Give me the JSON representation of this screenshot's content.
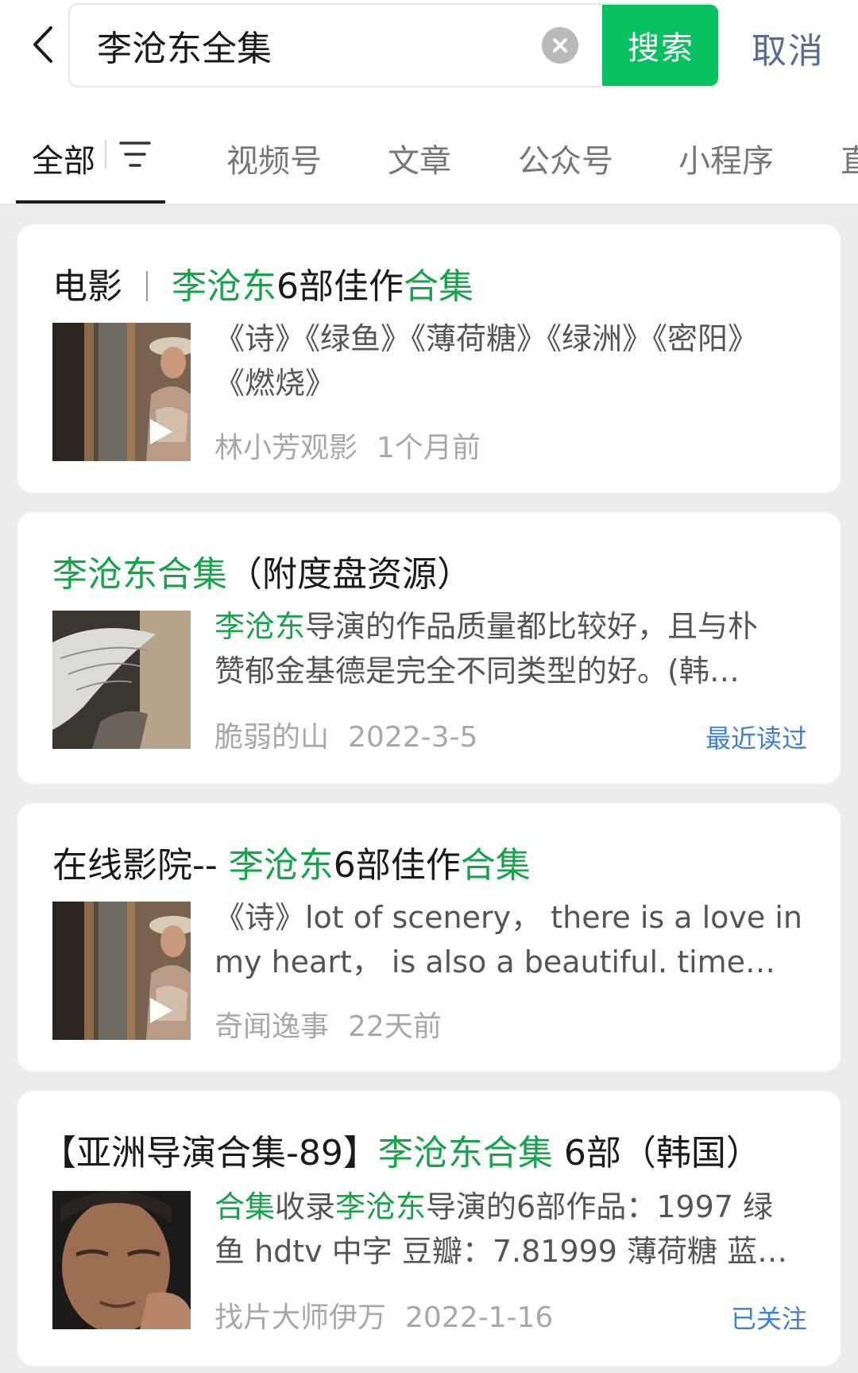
{
  "search": {
    "query": "李沧东全集",
    "submit_label": "搜索",
    "cancel_label": "取消"
  },
  "tabs": [
    {
      "label": "全部",
      "active": true
    },
    {
      "label": "视频号"
    },
    {
      "label": "文章"
    },
    {
      "label": "公众号"
    },
    {
      "label": "小程序"
    },
    {
      "label": "直"
    }
  ],
  "colors": {
    "accent_green": "#07c160",
    "highlight_green": "#17a34a",
    "link_blue": "#576b95",
    "badge_blue": "#3f7fd6"
  },
  "results": [
    {
      "category": "电影",
      "title_parts": [
        {
          "text": "李沧东",
          "hl": true
        },
        {
          "text": "6部佳作",
          "hl": false
        },
        {
          "text": "合集",
          "hl": true
        }
      ],
      "thumb": "woman-in-hat-video-thumb",
      "is_video": true,
      "desc_lines": [
        [
          {
            "text": "《诗》《绿鱼》《薄荷糖》《绿洲》《密阳》",
            "hl": false
          }
        ],
        [
          {
            "text": "《燃烧》",
            "hl": false
          }
        ]
      ],
      "source": "林小芳观影",
      "date": "1个月前",
      "badge": ""
    },
    {
      "category": "",
      "title_parts": [
        {
          "text": "李沧东合集",
          "hl": true
        },
        {
          "text": "（附度盘资源）",
          "hl": false
        }
      ],
      "thumb": "bird-feather-thumb",
      "is_video": false,
      "desc_lines": [
        [
          {
            "text": "李沧东",
            "hl": true
          },
          {
            "text": "导演的作品质量都比较好，且与朴",
            "hl": false
          }
        ],
        [
          {
            "text": "赞郁金基德是完全不同类型的好。(韩…",
            "hl": false
          }
        ]
      ],
      "source": "脆弱的山",
      "date": "2022-3-5",
      "badge": "最近读过"
    },
    {
      "category": "",
      "title_parts": [
        {
          "text": "在线影院-- ",
          "hl": false
        },
        {
          "text": "李沧东",
          "hl": true
        },
        {
          "text": "6部佳作",
          "hl": false
        },
        {
          "text": "合集",
          "hl": true
        }
      ],
      "thumb": "woman-in-hat-video-thumb",
      "is_video": true,
      "desc_lines": [
        [
          {
            "text": "《诗》lot of scenery， there is a love in",
            "hl": false
          }
        ],
        [
          {
            "text": "my heart， is also a beautiful. time…",
            "hl": false
          }
        ]
      ],
      "source": "奇闻逸事",
      "date": "22天前",
      "badge": ""
    },
    {
      "category": "",
      "title_parts": [
        {
          "text": "【亚洲导演合集-89】",
          "hl": false
        },
        {
          "text": "李沧东合集",
          "hl": true
        },
        {
          "text": " 6部（韩国）",
          "hl": false
        }
      ],
      "thumb": "director-portrait-thumb",
      "is_video": false,
      "desc_lines": [
        [
          {
            "text": "合集",
            "hl": true
          },
          {
            "text": "收录",
            "hl": false
          },
          {
            "text": "李沧东",
            "hl": true
          },
          {
            "text": "导演的6部作品：1997 绿",
            "hl": false
          }
        ],
        [
          {
            "text": "鱼 hdtv 中字 豆瓣：7.81999 薄荷糖 蓝…",
            "hl": false
          }
        ]
      ],
      "source": "找片大师伊万",
      "date": "2022-1-16",
      "badge": "已关注"
    }
  ]
}
